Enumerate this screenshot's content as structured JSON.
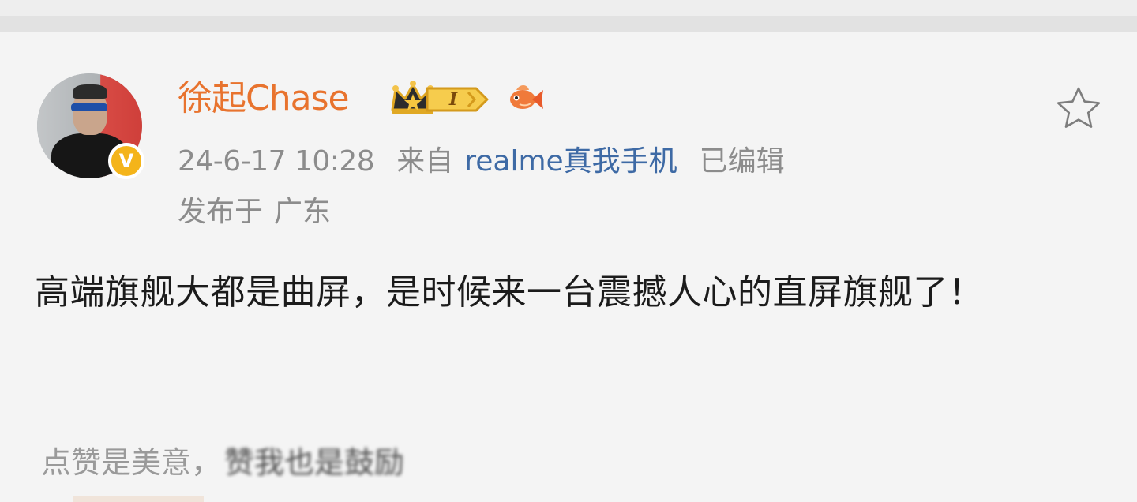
{
  "post": {
    "author": {
      "name": "徐起Chase",
      "verified_badge_label": "V",
      "level_label": "I",
      "crown_icon": "crown-icon",
      "fish_icon": "fish-icon"
    },
    "timestamp": "24-6-17 10:28",
    "source_prefix": "来自",
    "source_app": "realme真我手机",
    "edited_label": "已编辑",
    "location_prefix": "发布于",
    "location": "广东",
    "text": "高端旗舰大都是曲屏，是时候来一台震撼人心的直屏旗舰了！",
    "favorite_icon": "star-outline-icon"
  },
  "footer": {
    "like_hint": "点赞是美意，",
    "like_hint_tail": "赞我也是鼓励"
  },
  "colors": {
    "username": "#e8732e",
    "source_link": "#3e6aa5",
    "meta_gray": "#8c8c8c",
    "body_text": "#1b1b1b",
    "background": "#f4f4f4",
    "badge_gold": "#f4b41a"
  }
}
